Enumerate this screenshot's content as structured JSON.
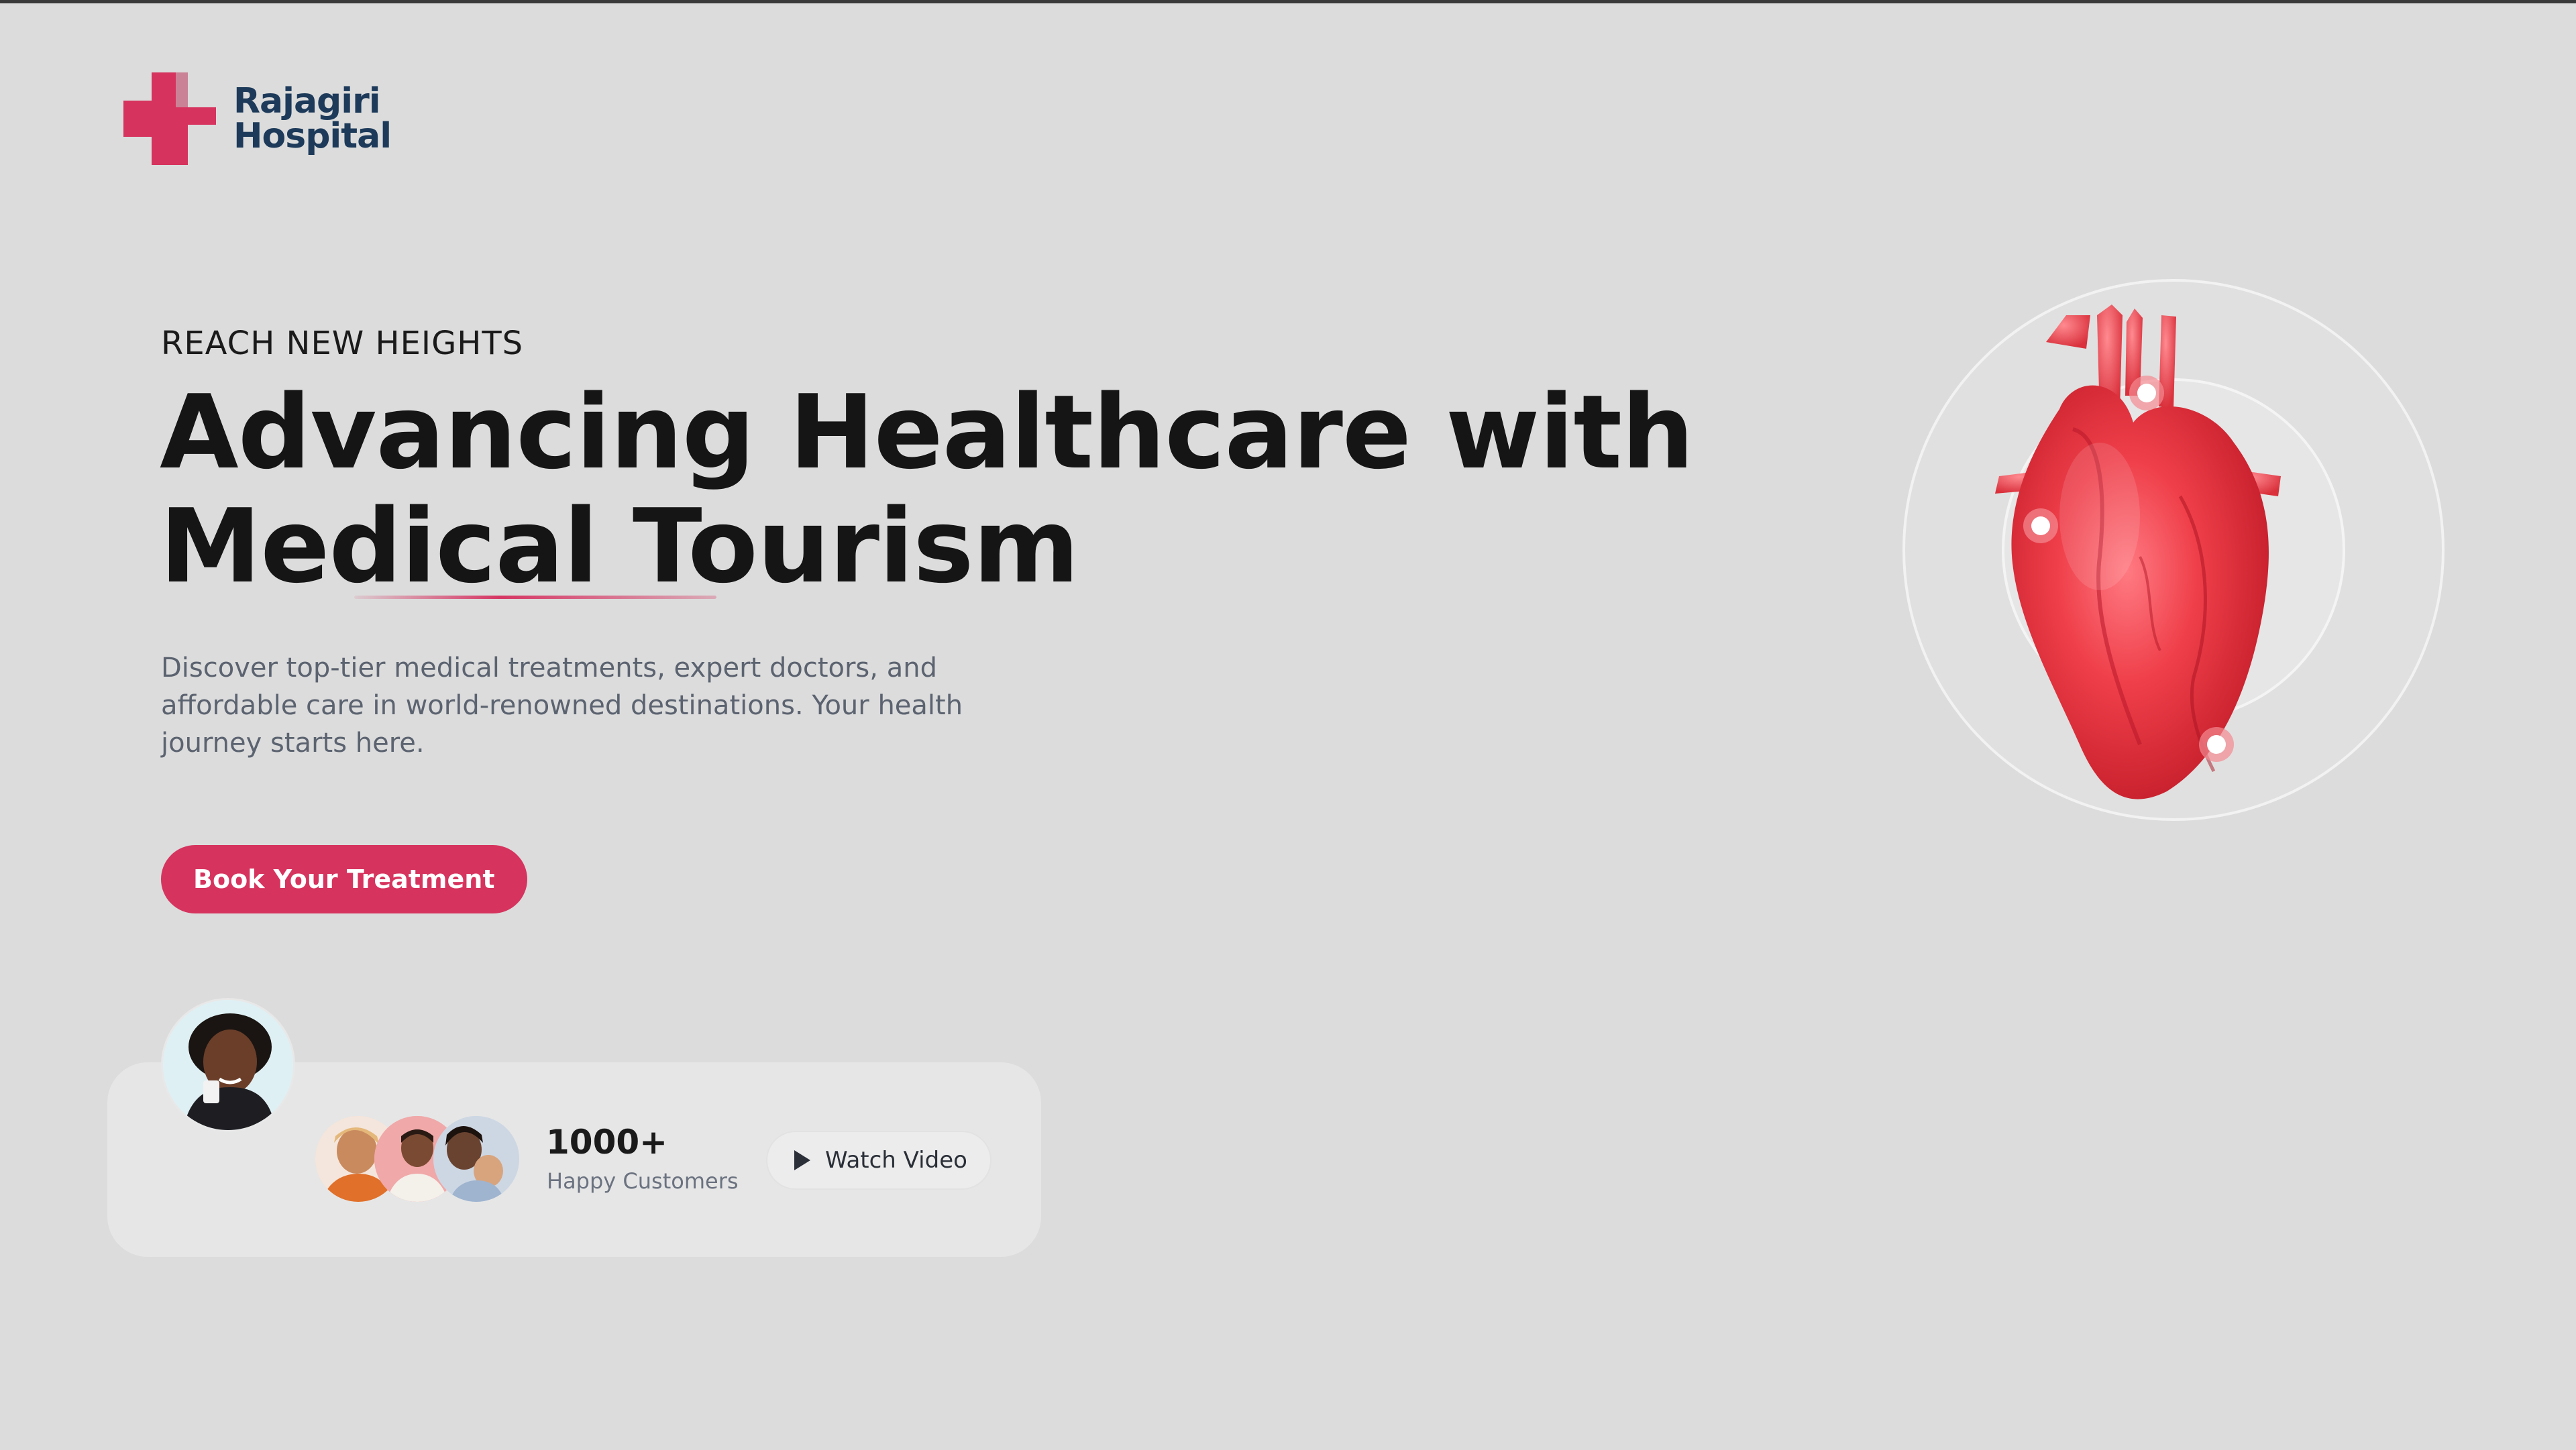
{
  "brand": {
    "name_line1": "Rajagiri",
    "name_line2": "Hospital",
    "accent_color": "#d6335e",
    "text_color": "#1d3a5a",
    "logo_icon": "medical-cross-icon"
  },
  "hero": {
    "eyebrow": "REACH NEW HEIGHTS",
    "headline_line1": "Advancing Healthcare with",
    "headline_line2": "Medical Tourism",
    "description": "Discover top-tier medical treatments, expert doctors, and affordable care in world-renowned destinations. Your health journey starts here.",
    "cta_label": "Book Your Treatment"
  },
  "social_proof": {
    "count": "1000+",
    "label": "Happy Customers",
    "watch_label": "Watch Video",
    "watch_icon": "play-icon"
  },
  "visual": {
    "image": "human-heart-illustration",
    "marker_color": "#ffffff"
  }
}
